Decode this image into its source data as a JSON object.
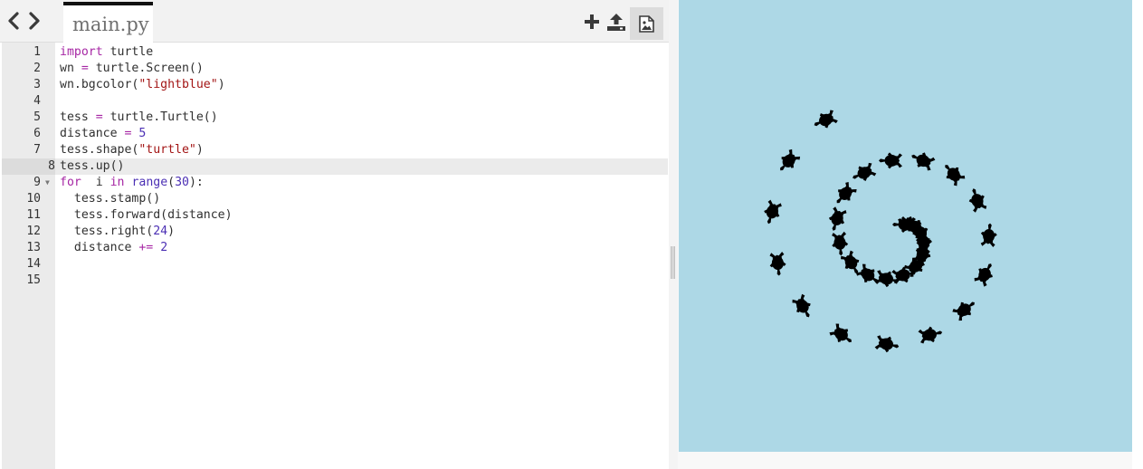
{
  "editor": {
    "file_tab": "main.py",
    "nav": {
      "back_icon": "chevron-left-icon",
      "forward_icon": "chevron-right-icon"
    },
    "toolbar": {
      "add_icon": "plus-icon",
      "upload_icon": "upload-icon",
      "image_icon": "image-icon"
    },
    "active_line": 8,
    "lines": [
      {
        "num": "1",
        "text": "import turtle"
      },
      {
        "num": "2",
        "text": "wn = turtle.Screen()"
      },
      {
        "num": "3",
        "text": "wn.bgcolor(\"lightblue\")"
      },
      {
        "num": "4",
        "text": ""
      },
      {
        "num": "5",
        "text": "tess = turtle.Turtle()"
      },
      {
        "num": "6",
        "text": "distance = 5"
      },
      {
        "num": "7",
        "text": "tess.shape(\"turtle\")"
      },
      {
        "num": "8",
        "text": "tess.up()"
      },
      {
        "num": "9",
        "text": "for  i in range(30):"
      },
      {
        "num": "10",
        "text": "  tess.stamp()"
      },
      {
        "num": "11",
        "text": "  tess.forward(distance)"
      },
      {
        "num": "12",
        "text": "  tess.right(24)"
      },
      {
        "num": "13",
        "text": "  distance += 2"
      },
      {
        "num": "14",
        "text": ""
      },
      {
        "num": "15",
        "text": ""
      }
    ]
  },
  "output": {
    "background_color": "#add8e6",
    "stamp_color": "#000000",
    "stamp_count": 30,
    "stamp_shape": "turtle"
  }
}
